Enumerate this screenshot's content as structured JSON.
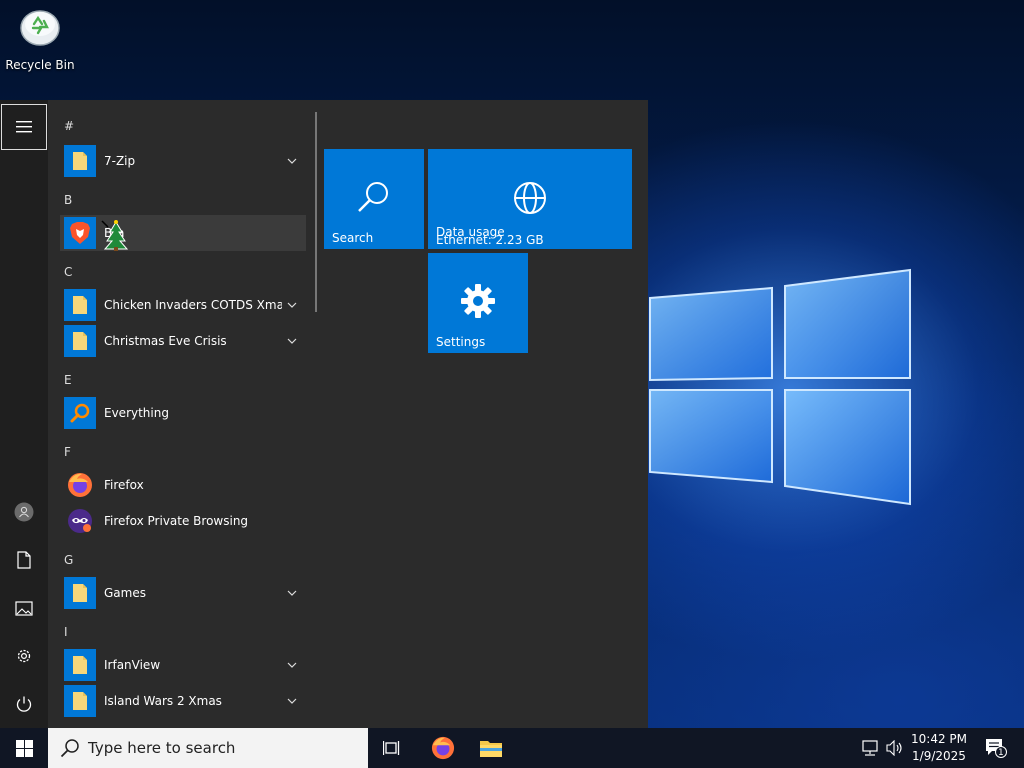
{
  "desktop": {
    "icons": [
      {
        "label": "Recycle Bin"
      }
    ]
  },
  "start_menu": {
    "sections": [
      {
        "letter": "#",
        "apps": [
          {
            "name": "7-Zip",
            "icon": "folder-icon",
            "expandable": true
          }
        ]
      },
      {
        "letter": "B",
        "apps": [
          {
            "name": "Brave",
            "icon": "brave-icon",
            "expandable": false
          }
        ]
      },
      {
        "letter": "C",
        "apps": [
          {
            "name": "Chicken Invaders COTDS Xmas",
            "icon": "folder-icon",
            "expandable": true
          },
          {
            "name": "Christmas Eve Crisis",
            "icon": "folder-icon",
            "expandable": true
          }
        ]
      },
      {
        "letter": "E",
        "apps": [
          {
            "name": "Everything",
            "icon": "magnifier-icon",
            "expandable": false
          }
        ]
      },
      {
        "letter": "F",
        "apps": [
          {
            "name": "Firefox",
            "icon": "firefox-icon",
            "expandable": false
          },
          {
            "name": "Firefox Private Browsing",
            "icon": "firefox-private-icon",
            "expandable": false
          }
        ]
      },
      {
        "letter": "G",
        "apps": [
          {
            "name": "Games",
            "icon": "folder-icon",
            "expandable": true
          }
        ]
      },
      {
        "letter": "I",
        "apps": [
          {
            "name": "IrfanView",
            "icon": "folder-icon",
            "expandable": true
          },
          {
            "name": "Island Wars 2 Xmas",
            "icon": "folder-icon",
            "expandable": true
          }
        ]
      }
    ],
    "brave_visible_text": "Bra",
    "tiles": {
      "search": "Search",
      "data_usage_title": "Data usage",
      "data_usage_value": "Ethernet: 2.23 GB",
      "settings": "Settings"
    },
    "rail": [
      "menu-icon",
      "user-icon",
      "documents-icon",
      "pictures-icon",
      "settings-icon",
      "power-icon"
    ]
  },
  "taskbar": {
    "search_placeholder": "Type here to search",
    "time": "10:42 PM",
    "date": "1/9/2025",
    "notification_count": "1"
  },
  "colors": {
    "accent": "#0078d7",
    "menu_bg": "#2b2b2b",
    "rail_bg": "#1f1f1f",
    "taskbar_bg": "#101624"
  }
}
